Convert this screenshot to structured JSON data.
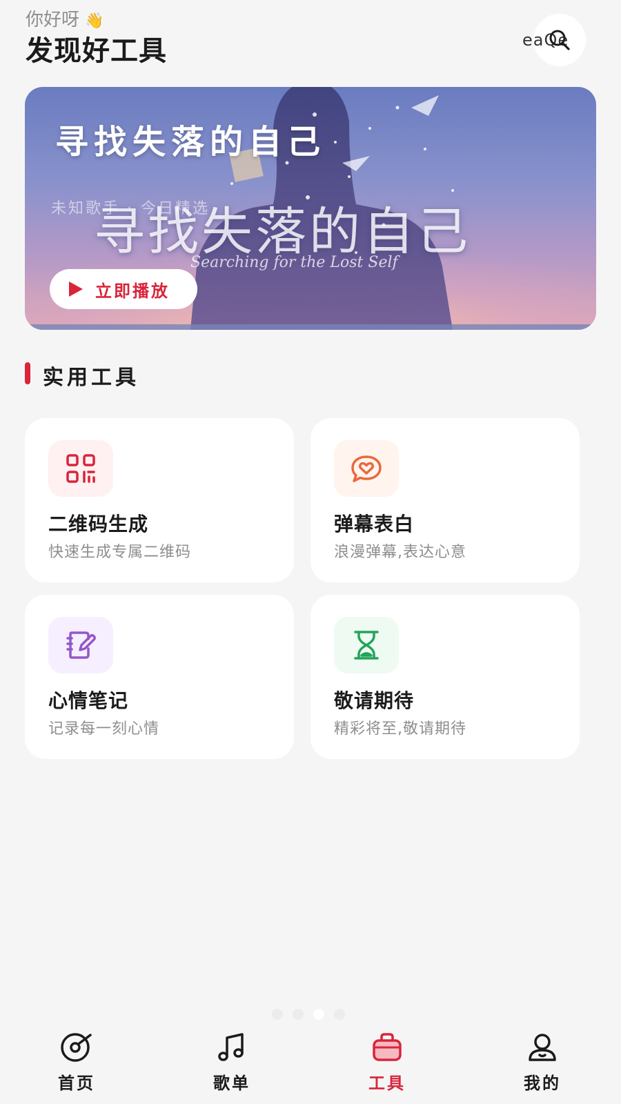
{
  "header": {
    "greeting": "你好呀",
    "title": "发现好工具",
    "search_overlay_text": "eaQe"
  },
  "banner": {
    "title": "寻找失落的自己",
    "subtitle": "未知歌手 · 今日精选",
    "art_title": "寻找失落的自己",
    "art_subtitle_en": "Searching for the Lost Self",
    "play_label": "立即播放"
  },
  "section": {
    "title": "实用工具"
  },
  "tools": [
    {
      "title": "二维码生成",
      "desc": "快速生成专属二维码",
      "icon": "qr-code-icon",
      "color": "#d9243a",
      "bg": "#fff0f1"
    },
    {
      "title": "弹幕表白",
      "desc": "浪漫弹幕,表达心意",
      "icon": "heart-chat-icon",
      "color": "#e8693a",
      "bg": "#fff4ee"
    },
    {
      "title": "心情笔记",
      "desc": "记录每一刻心情",
      "icon": "notebook-icon",
      "color": "#9457c9",
      "bg": "#f5efff"
    },
    {
      "title": "敬请期待",
      "desc": "精彩将至,敬请期待",
      "icon": "hourglass-icon",
      "color": "#22a559",
      "bg": "#eefaf2"
    }
  ],
  "pager": {
    "count": 4,
    "active_index": 2
  },
  "nav": {
    "active_color": "#d9243a",
    "items": [
      {
        "label": "首页",
        "icon": "vinyl-icon"
      },
      {
        "label": "歌单",
        "icon": "music-note-icon"
      },
      {
        "label": "工具",
        "icon": "toolbox-icon",
        "active": true
      },
      {
        "label": "我的",
        "icon": "user-icon"
      }
    ]
  }
}
